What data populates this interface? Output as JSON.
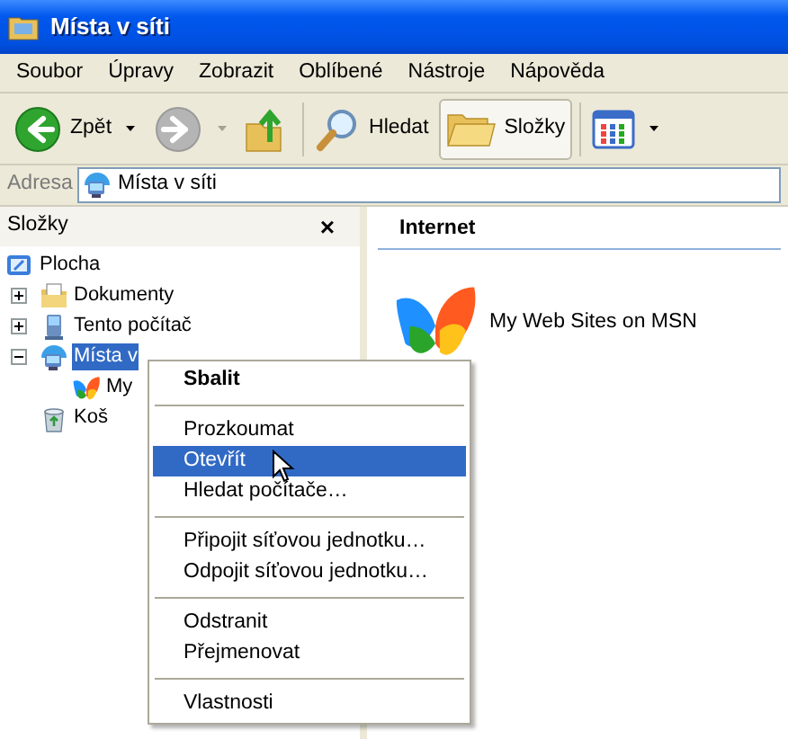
{
  "window": {
    "title": "Místa v síti"
  },
  "menu_bar": [
    "Soubor",
    "Úpravy",
    "Zobrazit",
    "Oblíbené",
    "Nástroje",
    "Nápověda"
  ],
  "toolbar": [
    {
      "kind": "back",
      "label": "Zpět",
      "disabled": false,
      "selected": false
    },
    {
      "kind": "forward",
      "disabled": true,
      "selected": false
    },
    {
      "kind": "up",
      "disabled": false,
      "selected": false
    },
    {
      "kind": "search",
      "label": "Hledat",
      "disabled": false,
      "selected": false
    },
    {
      "kind": "folders",
      "label": "Složky",
      "disabled": false,
      "selected": true
    },
    {
      "kind": "views",
      "disabled": false,
      "selected": false
    }
  ],
  "address_bar": {
    "label": "Adresa",
    "value": "Místa v síti"
  },
  "folders_pane": {
    "title": "Složky",
    "close": "×",
    "tree": [
      {
        "kind": "desktop",
        "label": "Plocha",
        "selected": false,
        "children": [
          {
            "kind": "documents",
            "label": "Dokumenty",
            "expanded": false,
            "selected": false
          },
          {
            "kind": "computer",
            "label": "Tento počítač",
            "expanded": false,
            "selected": false
          },
          {
            "kind": "network",
            "label": "Místa v",
            "expanded": true,
            "selected": true,
            "children": [
              {
                "kind": "msn",
                "label": "My",
                "selected": false
              }
            ]
          },
          {
            "kind": "bin",
            "label": "Koš",
            "selected": false
          }
        ]
      }
    ]
  },
  "content": {
    "group_title": "Internet",
    "items": [
      {
        "kind": "msn",
        "label": "My Web Sites on MSN"
      }
    ]
  },
  "context_menu": {
    "groups": [
      [
        {
          "label": "Sbalit",
          "default": true,
          "selected": false
        }
      ],
      [
        {
          "label": "Prozkoumat",
          "default": false,
          "selected": false
        },
        {
          "label": "Otevřít",
          "default": false,
          "selected": true
        },
        {
          "label": "Hledat počítače…",
          "default": false,
          "selected": false
        }
      ],
      [
        {
          "label": "Připojit síťovou jednotku…",
          "default": false,
          "selected": false
        },
        {
          "label": "Odpojit síťovou jednotku…",
          "default": false,
          "selected": false
        }
      ],
      [
        {
          "label": "Odstranit",
          "default": false,
          "selected": false
        },
        {
          "label": "Přejmenovat",
          "default": false,
          "selected": false
        }
      ],
      [
        {
          "label": "Vlastnosti",
          "default": false,
          "selected": false
        }
      ]
    ]
  }
}
